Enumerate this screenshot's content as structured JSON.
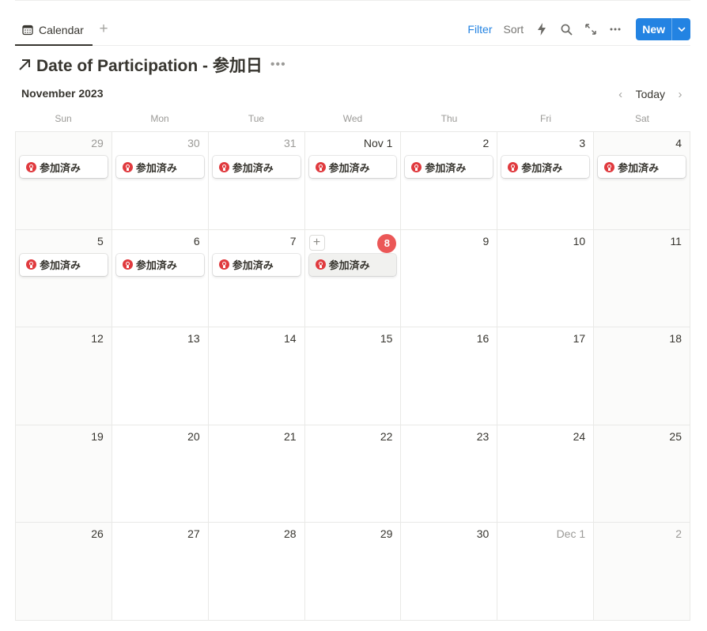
{
  "tabs": [
    {
      "label": "Calendar",
      "active": true
    }
  ],
  "toolbar": {
    "filter_label": "Filter",
    "sort_label": "Sort",
    "new_label": "New",
    "icons": [
      "lightning-icon",
      "search-icon",
      "expand-icon",
      "more-icon"
    ]
  },
  "page": {
    "title": "Date of Participation - 参加日"
  },
  "calendar": {
    "month_label": "November 2023",
    "today_label": "Today",
    "weekdays": [
      "Sun",
      "Mon",
      "Tue",
      "Wed",
      "Thu",
      "Fri",
      "Sat"
    ],
    "cells": [
      {
        "label": "29",
        "muted": true,
        "event": "参加済み"
      },
      {
        "label": "30",
        "muted": true,
        "event": "参加済み"
      },
      {
        "label": "31",
        "muted": true,
        "event": "参加済み"
      },
      {
        "label": "Nov 1",
        "event": "参加済み"
      },
      {
        "label": "2",
        "event": "参加済み"
      },
      {
        "label": "3",
        "event": "参加済み"
      },
      {
        "label": "4",
        "event": "参加済み"
      },
      {
        "label": "5",
        "event": "参加済み"
      },
      {
        "label": "6",
        "event": "参加済み"
      },
      {
        "label": "7",
        "event": "参加済み"
      },
      {
        "label": "8",
        "today": true,
        "event": "参加済み"
      },
      {
        "label": "9"
      },
      {
        "label": "10"
      },
      {
        "label": "11"
      },
      {
        "label": "12"
      },
      {
        "label": "13"
      },
      {
        "label": "14"
      },
      {
        "label": "15"
      },
      {
        "label": "16"
      },
      {
        "label": "17"
      },
      {
        "label": "18"
      },
      {
        "label": "19"
      },
      {
        "label": "20"
      },
      {
        "label": "21"
      },
      {
        "label": "22"
      },
      {
        "label": "23"
      },
      {
        "label": "24"
      },
      {
        "label": "25"
      },
      {
        "label": "26"
      },
      {
        "label": "27"
      },
      {
        "label": "28"
      },
      {
        "label": "29"
      },
      {
        "label": "30"
      },
      {
        "label": "Dec 1",
        "muted": true
      },
      {
        "label": "2",
        "muted": true
      }
    ]
  },
  "colors": {
    "accent": "#2383e2",
    "today": "#eb5757",
    "badge": "#e03a3e"
  }
}
